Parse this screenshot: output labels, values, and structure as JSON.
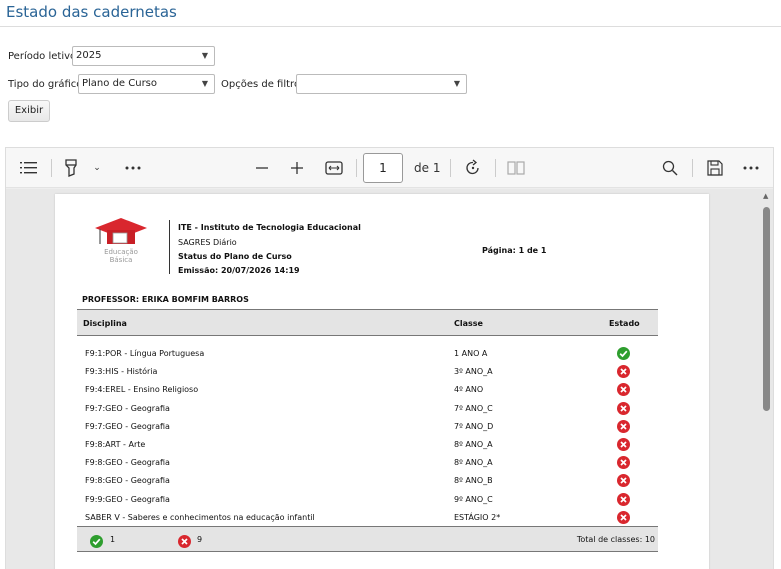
{
  "page": {
    "title": "Estado das cadernetas"
  },
  "filters": {
    "periodo_label": "Período letivo:",
    "periodo_value": "2025",
    "tipo_label": "Tipo do gráfico:",
    "tipo_value": "Plano de Curso",
    "opcoes_label": "Opções de filtro:",
    "opcoes_value": "",
    "exibir_label": "Exibir"
  },
  "viewer": {
    "toolbar": {
      "page_number": "1",
      "page_of": "de 1",
      "icons": [
        "list-icon",
        "highlighter-icon",
        "more-icon",
        "zoom-out-icon",
        "zoom-in-icon",
        "fit-width-icon",
        "rotate-icon",
        "page-view-icon",
        "search-icon",
        "save-icon",
        "more-options-icon"
      ]
    }
  },
  "report": {
    "logo_text": "Educação Básica",
    "institution": "ITE - Instituto de Tecnologia Educacional",
    "system": "SAGRES Diário",
    "report_title": "Status do Plano de Curso",
    "emission": "Emissão: 20/07/2026 14:19",
    "page_count": "Página: 1 de 1",
    "professor": "PROFESSOR:  ERIKA BOMFIM BARROS",
    "columns": {
      "disciplina": "Disciplina",
      "classe": "Classe",
      "estado": "Estado"
    },
    "rows": [
      {
        "disciplina": "F9:1:POR - Língua Portuguesa",
        "classe": "1 ANO A",
        "estado": "ok"
      },
      {
        "disciplina": "F9:3:HIS - História",
        "classe": "3º ANO_A",
        "estado": "error"
      },
      {
        "disciplina": "F9:4:EREL - Ensino Religioso",
        "classe": "4º ANO",
        "estado": "error"
      },
      {
        "disciplina": "F9:7:GEO - Geografia",
        "classe": "7º ANO_C",
        "estado": "error"
      },
      {
        "disciplina": "F9:7:GEO - Geografia",
        "classe": "7º ANO_D",
        "estado": "error"
      },
      {
        "disciplina": "F9:8:ART - Arte",
        "classe": "8º ANO_A",
        "estado": "error"
      },
      {
        "disciplina": "F9:8:GEO - Geografia",
        "classe": "8º ANO_A",
        "estado": "error"
      },
      {
        "disciplina": "F9:8:GEO - Geografia",
        "classe": "8º ANO_B",
        "estado": "error"
      },
      {
        "disciplina": "F9:9:GEO - Geografia",
        "classe": "9º ANO_C",
        "estado": "error"
      },
      {
        "disciplina": "SABER V - Saberes e conhecimentos na educação infantil",
        "classe": "ESTÁGIO 2*",
        "estado": "error"
      }
    ],
    "footer": {
      "ok_count": "1",
      "error_count": "9",
      "total": "Total de classes: 10"
    },
    "colors": {
      "ok": "#2e9e2e",
      "error": "#d9272e"
    }
  }
}
